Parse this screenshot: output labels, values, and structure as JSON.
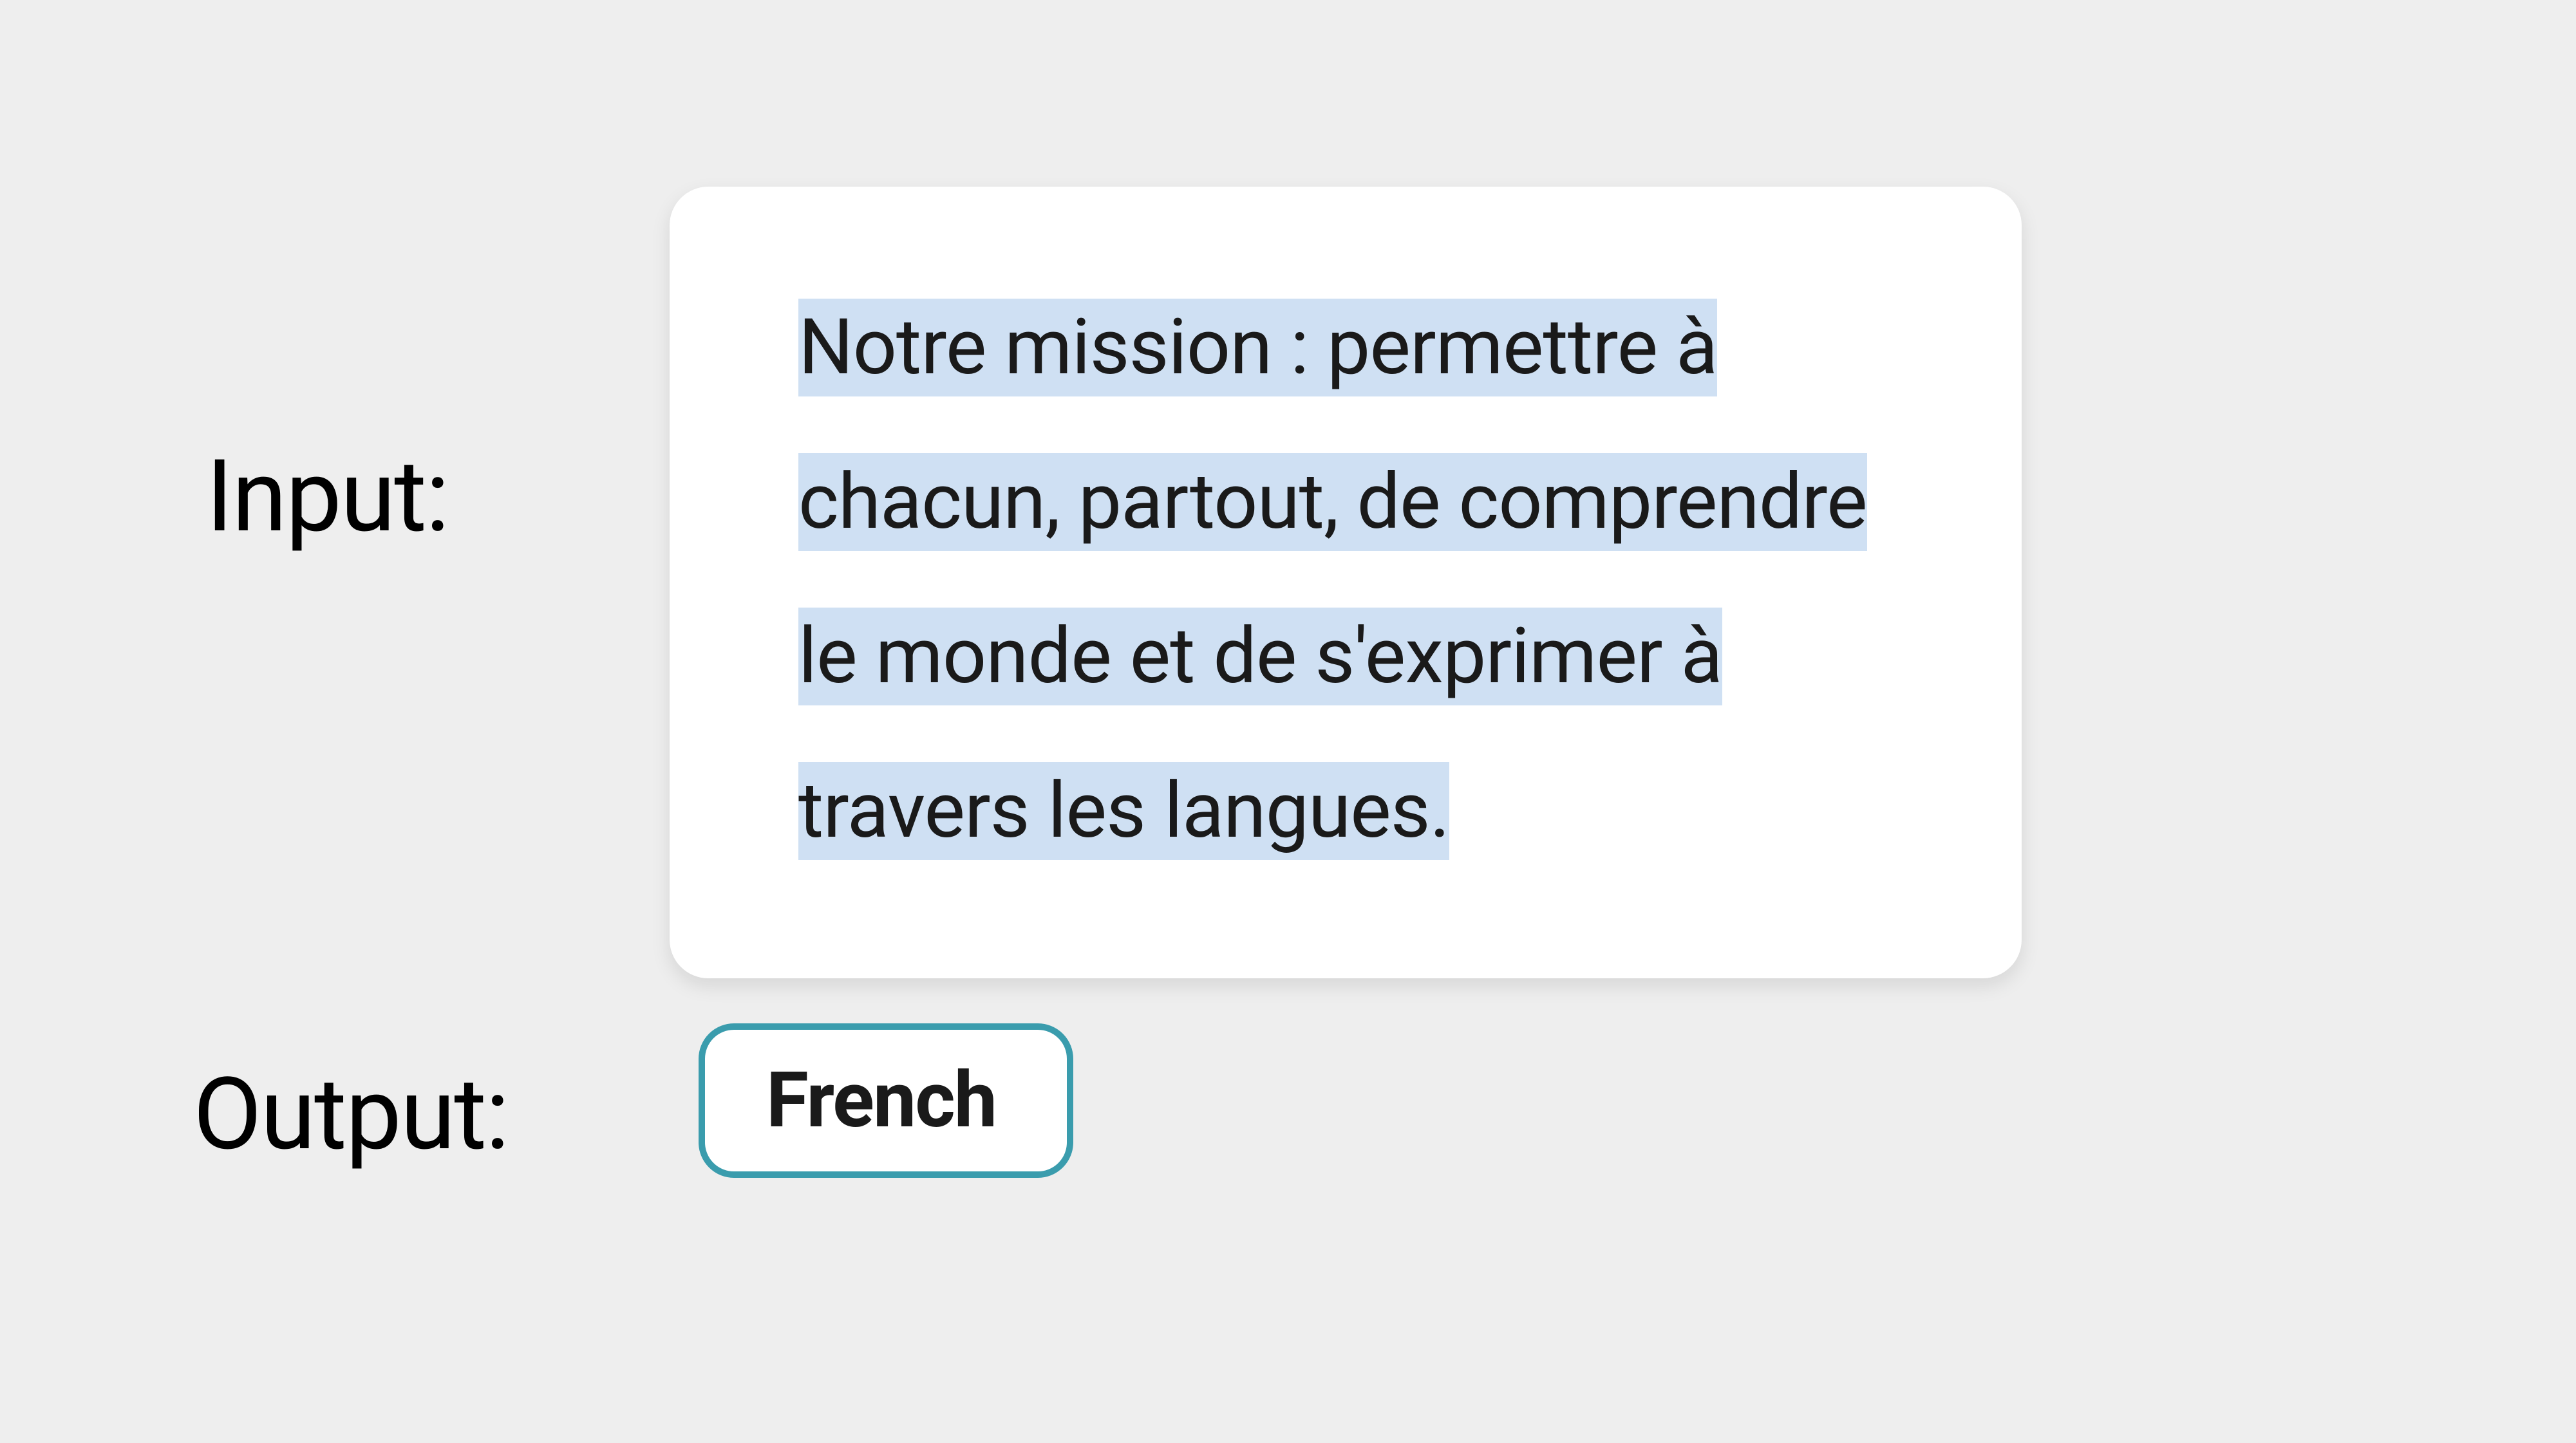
{
  "labels": {
    "input": "Input:",
    "output": "Output:"
  },
  "input_text": "Notre mission : permettre à chacun, partout, de comprendre le monde et de s'exprimer à travers les langues.",
  "output_value": "French",
  "colors": {
    "highlight_bg": "#cfe0f3",
    "chip_border": "#3a9cad",
    "page_bg": "#eeeeee",
    "card_bg": "#ffffff"
  }
}
